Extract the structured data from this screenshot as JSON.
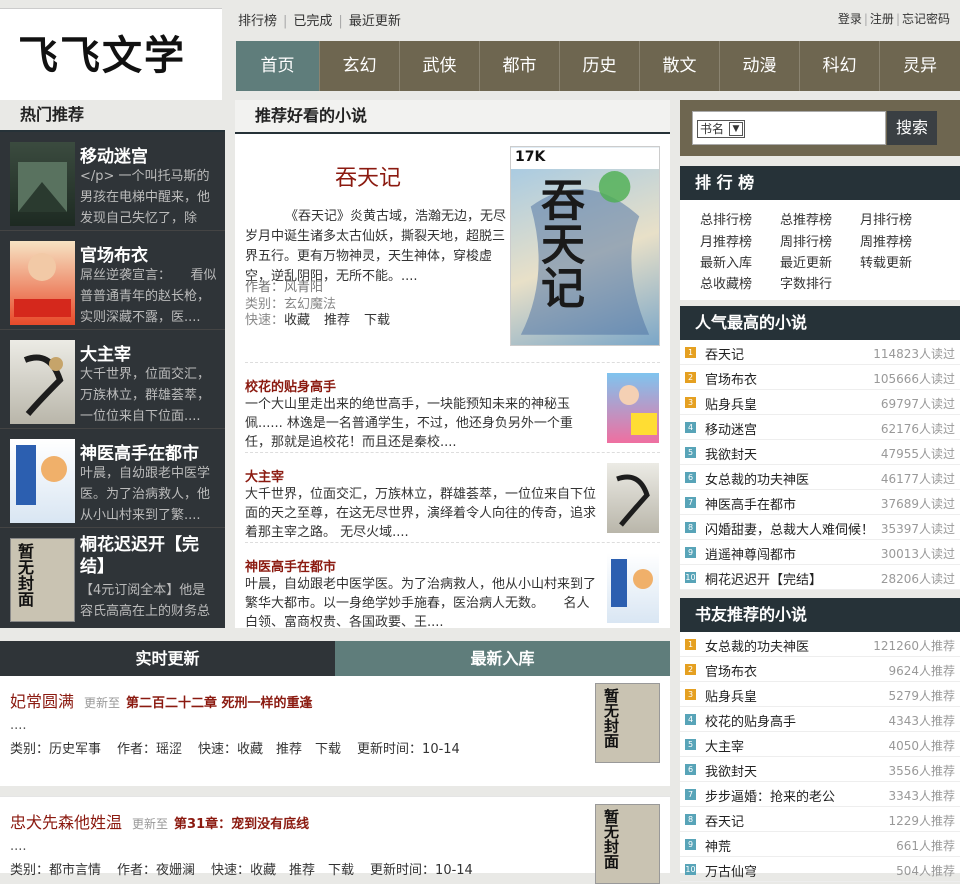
{
  "logo": "飞飞文学",
  "toplinks": [
    "排行榜",
    "已完成",
    "最近更新"
  ],
  "userlinks": [
    "登录",
    "注册",
    "忘记密码"
  ],
  "nav": [
    "首页",
    "玄幻",
    "武侠",
    "都市",
    "历史",
    "散文",
    "动漫",
    "科幻",
    "灵异"
  ],
  "hot": {
    "title": "热门推荐",
    "items": [
      {
        "name": "移动迷宫",
        "desc": "</p> 一个叫托马斯的男孩在电梯中醒来，他发现自己失忆了，除了...."
      },
      {
        "name": "官场布衣",
        "desc": "屌丝逆袭宣言：　　看似普普通青年的赵长枪，实则深藏不露，医...."
      },
      {
        "name": "大主宰",
        "desc": "大千世界，位面交汇，万族林立，群雄荟萃，一位位来自下位面...."
      },
      {
        "name": "神医高手在都市",
        "desc": "叶晨，自幼跟老中医学医。为了治病救人，他从小山村来到了繁...."
      },
      {
        "name": "桐花迟迟开【完结】",
        "desc": "【4元订阅全本】他是容氏高高在上的财务总"
      }
    ]
  },
  "covers": {
    "placeholder": "暂无封面",
    "featured_badge": "17K",
    "featured_title": "吞天记"
  },
  "mid": {
    "title": "推荐好看的小说",
    "featured": {
      "name": "吞天记",
      "desc": "《吞天记》炎黄古域，浩瀚无边，无尽岁月中诞生诸多太古仙妖，撕裂天地，超脱三界五行。更有万物神灵，天生神体，穿梭虚空，逆乱阴阳，无所不能。....",
      "author": "作者：风青阳",
      "category": "类别：玄幻魔法",
      "quick": "快速：",
      "q1": "收藏",
      "q2": "推荐",
      "q3": "下载"
    },
    "items": [
      {
        "name": "校花的贴身高手",
        "desc": "一个大山里走出来的绝世高手，一块能预知未来的神秘玉佩...... 林逸是一名普通学生，不过，他还身负另外一个重任，那就是追校花！而且还是秦校...."
      },
      {
        "name": "大主宰",
        "desc": "大千世界，位面交汇，万族林立，群雄荟萃，一位位来自下位面的天之至尊，在这无尽世界，演绎着令人向往的传奇，追求着那主宰之路。 无尽火域...."
      },
      {
        "name": "神医高手在都市",
        "desc": "叶晨，自幼跟老中医学医。为了治病救人，他从小山村来到了繁华大都市。以一身绝学妙手施春，医治病人无数。　　名人白领、富商权贵、各国政要、王...."
      }
    ]
  },
  "tabs": {
    "realtime": "实时更新",
    "newest": "最新入库"
  },
  "updates": [
    {
      "name": "妃常圆满",
      "label": "更新至",
      "chapter": "第二百二十二章 死刑一样的重逢",
      "ellipsis": "....",
      "cat": "类别：历史军事",
      "author": "作者：瑶涩",
      "quick": "快速：收藏　推荐　下载",
      "time": "更新时间：10-14"
    },
    {
      "name": "忠犬先森他姓温",
      "label": "更新至",
      "chapter": "第31章：宠到没有底线",
      "ellipsis": "....",
      "cat": "类别：都市言情",
      "author": "作者：夜姗澜",
      "quick": "快速：收藏　推荐　下载",
      "time": "更新时间：10-14"
    }
  ],
  "search": {
    "select": "书名",
    "button": "搜索"
  },
  "rank": {
    "title": "排 行 榜",
    "links": [
      "总排行榜",
      "总推荐榜",
      "月排行榜",
      "月推荐榜",
      "周排行榜",
      "周推荐榜",
      "最新入库",
      "最近更新",
      "转载更新",
      "总收藏榜",
      "字数排行"
    ]
  },
  "popular": {
    "title": "人气最高的小说",
    "items": [
      {
        "t": "吞天记",
        "c": "114823人读过"
      },
      {
        "t": "官场布衣",
        "c": "105666人读过"
      },
      {
        "t": "贴身兵皇",
        "c": "69797人读过"
      },
      {
        "t": "移动迷宫",
        "c": "62176人读过"
      },
      {
        "t": "我欲封天",
        "c": "47955人读过"
      },
      {
        "t": "女总裁的功夫神医",
        "c": "46177人读过"
      },
      {
        "t": "神医高手在都市",
        "c": "37689人读过"
      },
      {
        "t": "闪婚甜妻，总裁大人难伺候！",
        "c": "35397人读过"
      },
      {
        "t": "逍遥神尊闯都市",
        "c": "30013人读过"
      },
      {
        "t": "桐花迟迟开【完结】",
        "c": "28206人读过"
      }
    ]
  },
  "friends": {
    "title": "书友推荐的小说",
    "items": [
      {
        "t": "女总裁的功夫神医",
        "c": "121260人推荐"
      },
      {
        "t": "官场布衣",
        "c": "9624人推荐"
      },
      {
        "t": "贴身兵皇",
        "c": "5279人推荐"
      },
      {
        "t": "校花的贴身高手",
        "c": "4343人推荐"
      },
      {
        "t": "大主宰",
        "c": "4050人推荐"
      },
      {
        "t": "我欲封天",
        "c": "3556人推荐"
      },
      {
        "t": "步步逼婚：抢来的老公",
        "c": "3343人推荐"
      },
      {
        "t": "吞天记",
        "c": "1229人推荐"
      },
      {
        "t": "神荒",
        "c": "661人推荐"
      },
      {
        "t": "万古仙穹",
        "c": "504人推荐"
      }
    ]
  },
  "rank_numbers": [
    "1",
    "2",
    "3",
    "4",
    "5",
    "6",
    "7",
    "8",
    "9",
    "10"
  ],
  "colors": {
    "top3": "#e5a021",
    "rest": "#58a4b8"
  }
}
